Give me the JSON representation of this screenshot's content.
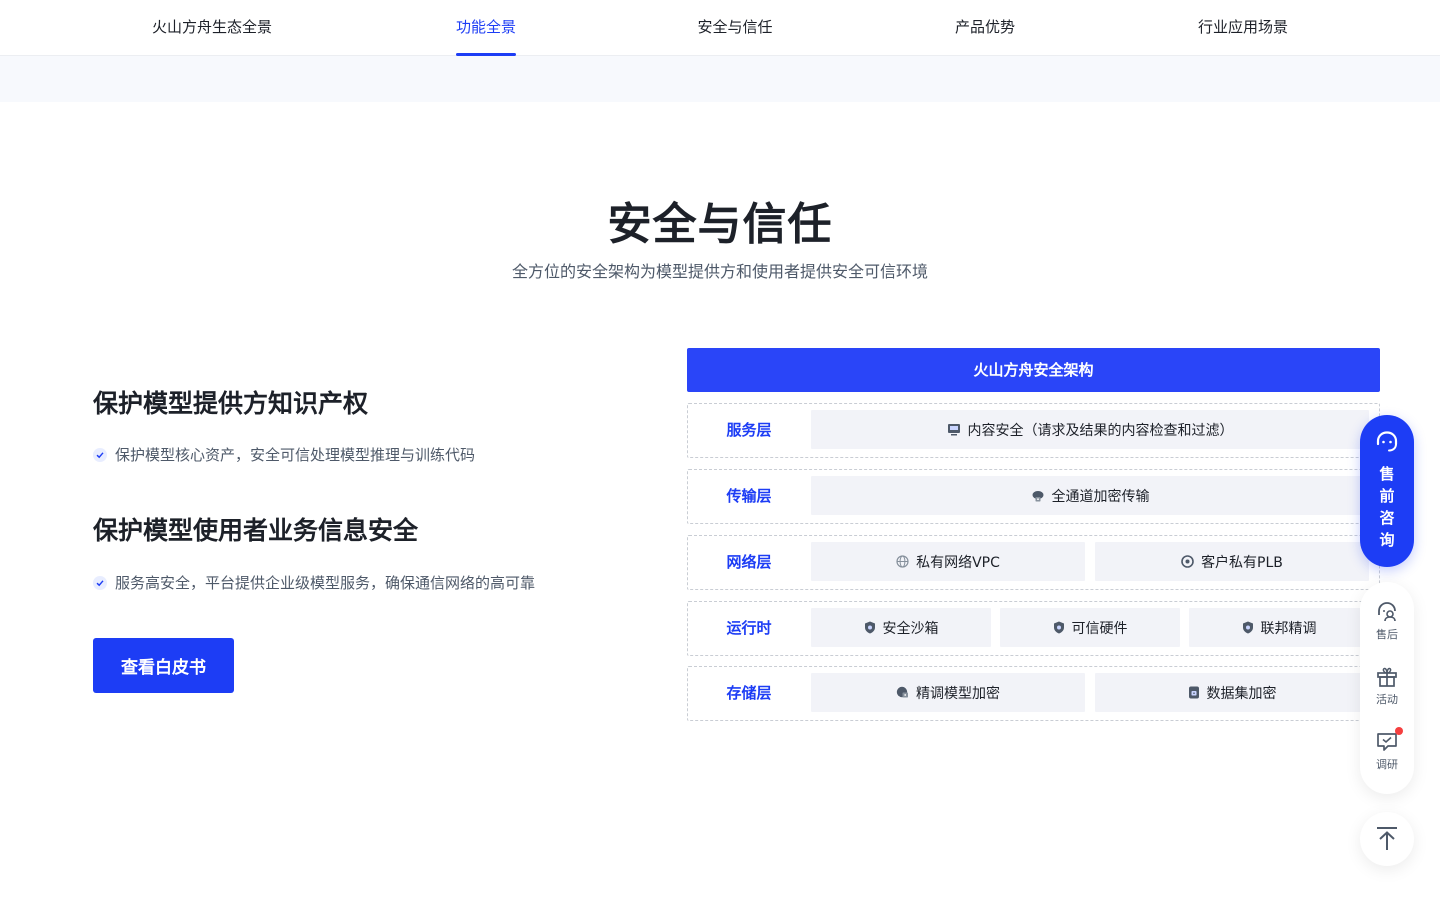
{
  "nav": {
    "items": [
      {
        "label": "火山方舟生态全景",
        "active": false
      },
      {
        "label": "功能全景",
        "active": true
      },
      {
        "label": "安全与信任",
        "active": false
      },
      {
        "label": "产品优势",
        "active": false
      },
      {
        "label": "行业应用场景",
        "active": false
      }
    ]
  },
  "section": {
    "title": "安全与信任",
    "subtitle": "全方位的安全架构为模型提供方和使用者提供安全可信环境"
  },
  "features": [
    {
      "title": "保护模型提供方知识产权",
      "desc": "保护模型核心资产，安全可信处理模型推理与训练代码"
    },
    {
      "title": "保护模型使用者业务信息安全",
      "desc": "服务高安全，平台提供企业级模型服务，确保通信网络的高可靠"
    }
  ],
  "cta": {
    "label": "查看白皮书"
  },
  "architecture": {
    "title": "火山方舟安全架构",
    "layers": [
      {
        "name": "服务层",
        "cells": [
          {
            "label": "内容安全（请求及结果的内容检查和过滤）",
            "icon": "monitor-icon"
          }
        ]
      },
      {
        "name": "传输层",
        "cells": [
          {
            "label": "全通道加密传输",
            "icon": "cloud-lock-icon"
          }
        ]
      },
      {
        "name": "网络层",
        "cells": [
          {
            "label": "私有网络VPC",
            "icon": "globe-icon"
          },
          {
            "label": "客户私有PLB",
            "icon": "balancer-icon"
          }
        ]
      },
      {
        "name": "运行时",
        "cells": [
          {
            "label": "安全沙箱",
            "icon": "shield-icon"
          },
          {
            "label": "可信硬件",
            "icon": "shield-icon"
          },
          {
            "label": "联邦精调",
            "icon": "shield-icon"
          }
        ]
      },
      {
        "name": "存储层",
        "cells": [
          {
            "label": "精调模型加密",
            "icon": "model-lock-icon"
          },
          {
            "label": "数据集加密",
            "icon": "database-lock-icon"
          }
        ]
      }
    ]
  },
  "floating": {
    "consult": "售前咨询",
    "after_sales": "售后",
    "activity": "活动",
    "survey": "调研"
  },
  "colors": {
    "accent": "#1d3df5",
    "text": "#1d2129",
    "muted": "#4e5969"
  }
}
